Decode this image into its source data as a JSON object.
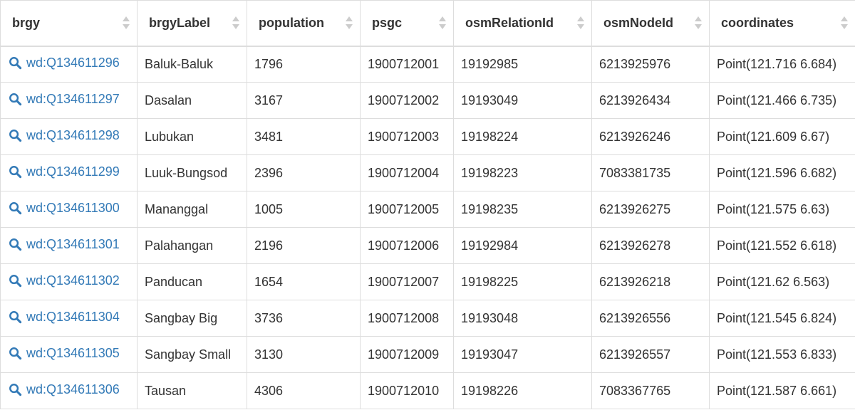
{
  "colors": {
    "link": "#337ab7",
    "border": "#dddddd",
    "text": "#333333",
    "sort_arrow": "#cccccc"
  },
  "columns": [
    "brgy",
    "brgyLabel",
    "population",
    "psgc",
    "osmRelationId",
    "osmNodeId",
    "coordinates"
  ],
  "rows": [
    [
      "wd:Q134611296",
      "Baluk-Baluk",
      "1796",
      "1900712001",
      "19192985",
      "6213925976",
      "Point(121.716 6.684)"
    ],
    [
      "wd:Q134611297",
      "Dasalan",
      "3167",
      "1900712002",
      "19193049",
      "6213926434",
      "Point(121.466 6.735)"
    ],
    [
      "wd:Q134611298",
      "Lubukan",
      "3481",
      "1900712003",
      "19198224",
      "6213926246",
      "Point(121.609 6.67)"
    ],
    [
      "wd:Q134611299",
      "Luuk-Bungsod",
      "2396",
      "1900712004",
      "19198223",
      "7083381735",
      "Point(121.596 6.682)"
    ],
    [
      "wd:Q134611300",
      "Mananggal",
      "1005",
      "1900712005",
      "19198235",
      "6213926275",
      "Point(121.575 6.63)"
    ],
    [
      "wd:Q134611301",
      "Palahangan",
      "2196",
      "1900712006",
      "19192984",
      "6213926278",
      "Point(121.552 6.618)"
    ],
    [
      "wd:Q134611302",
      "Panducan",
      "1654",
      "1900712007",
      "19198225",
      "6213926218",
      "Point(121.62 6.563)"
    ],
    [
      "wd:Q134611304",
      "Sangbay Big",
      "3736",
      "1900712008",
      "19193048",
      "6213926556",
      "Point(121.545 6.824)"
    ],
    [
      "wd:Q134611305",
      "Sangbay Small",
      "3130",
      "1900712009",
      "19193047",
      "6213926557",
      "Point(121.553 6.833)"
    ],
    [
      "wd:Q134611306",
      "Tausan",
      "4306",
      "1900712010",
      "19198226",
      "7083367765",
      "Point(121.587 6.661)"
    ]
  ]
}
